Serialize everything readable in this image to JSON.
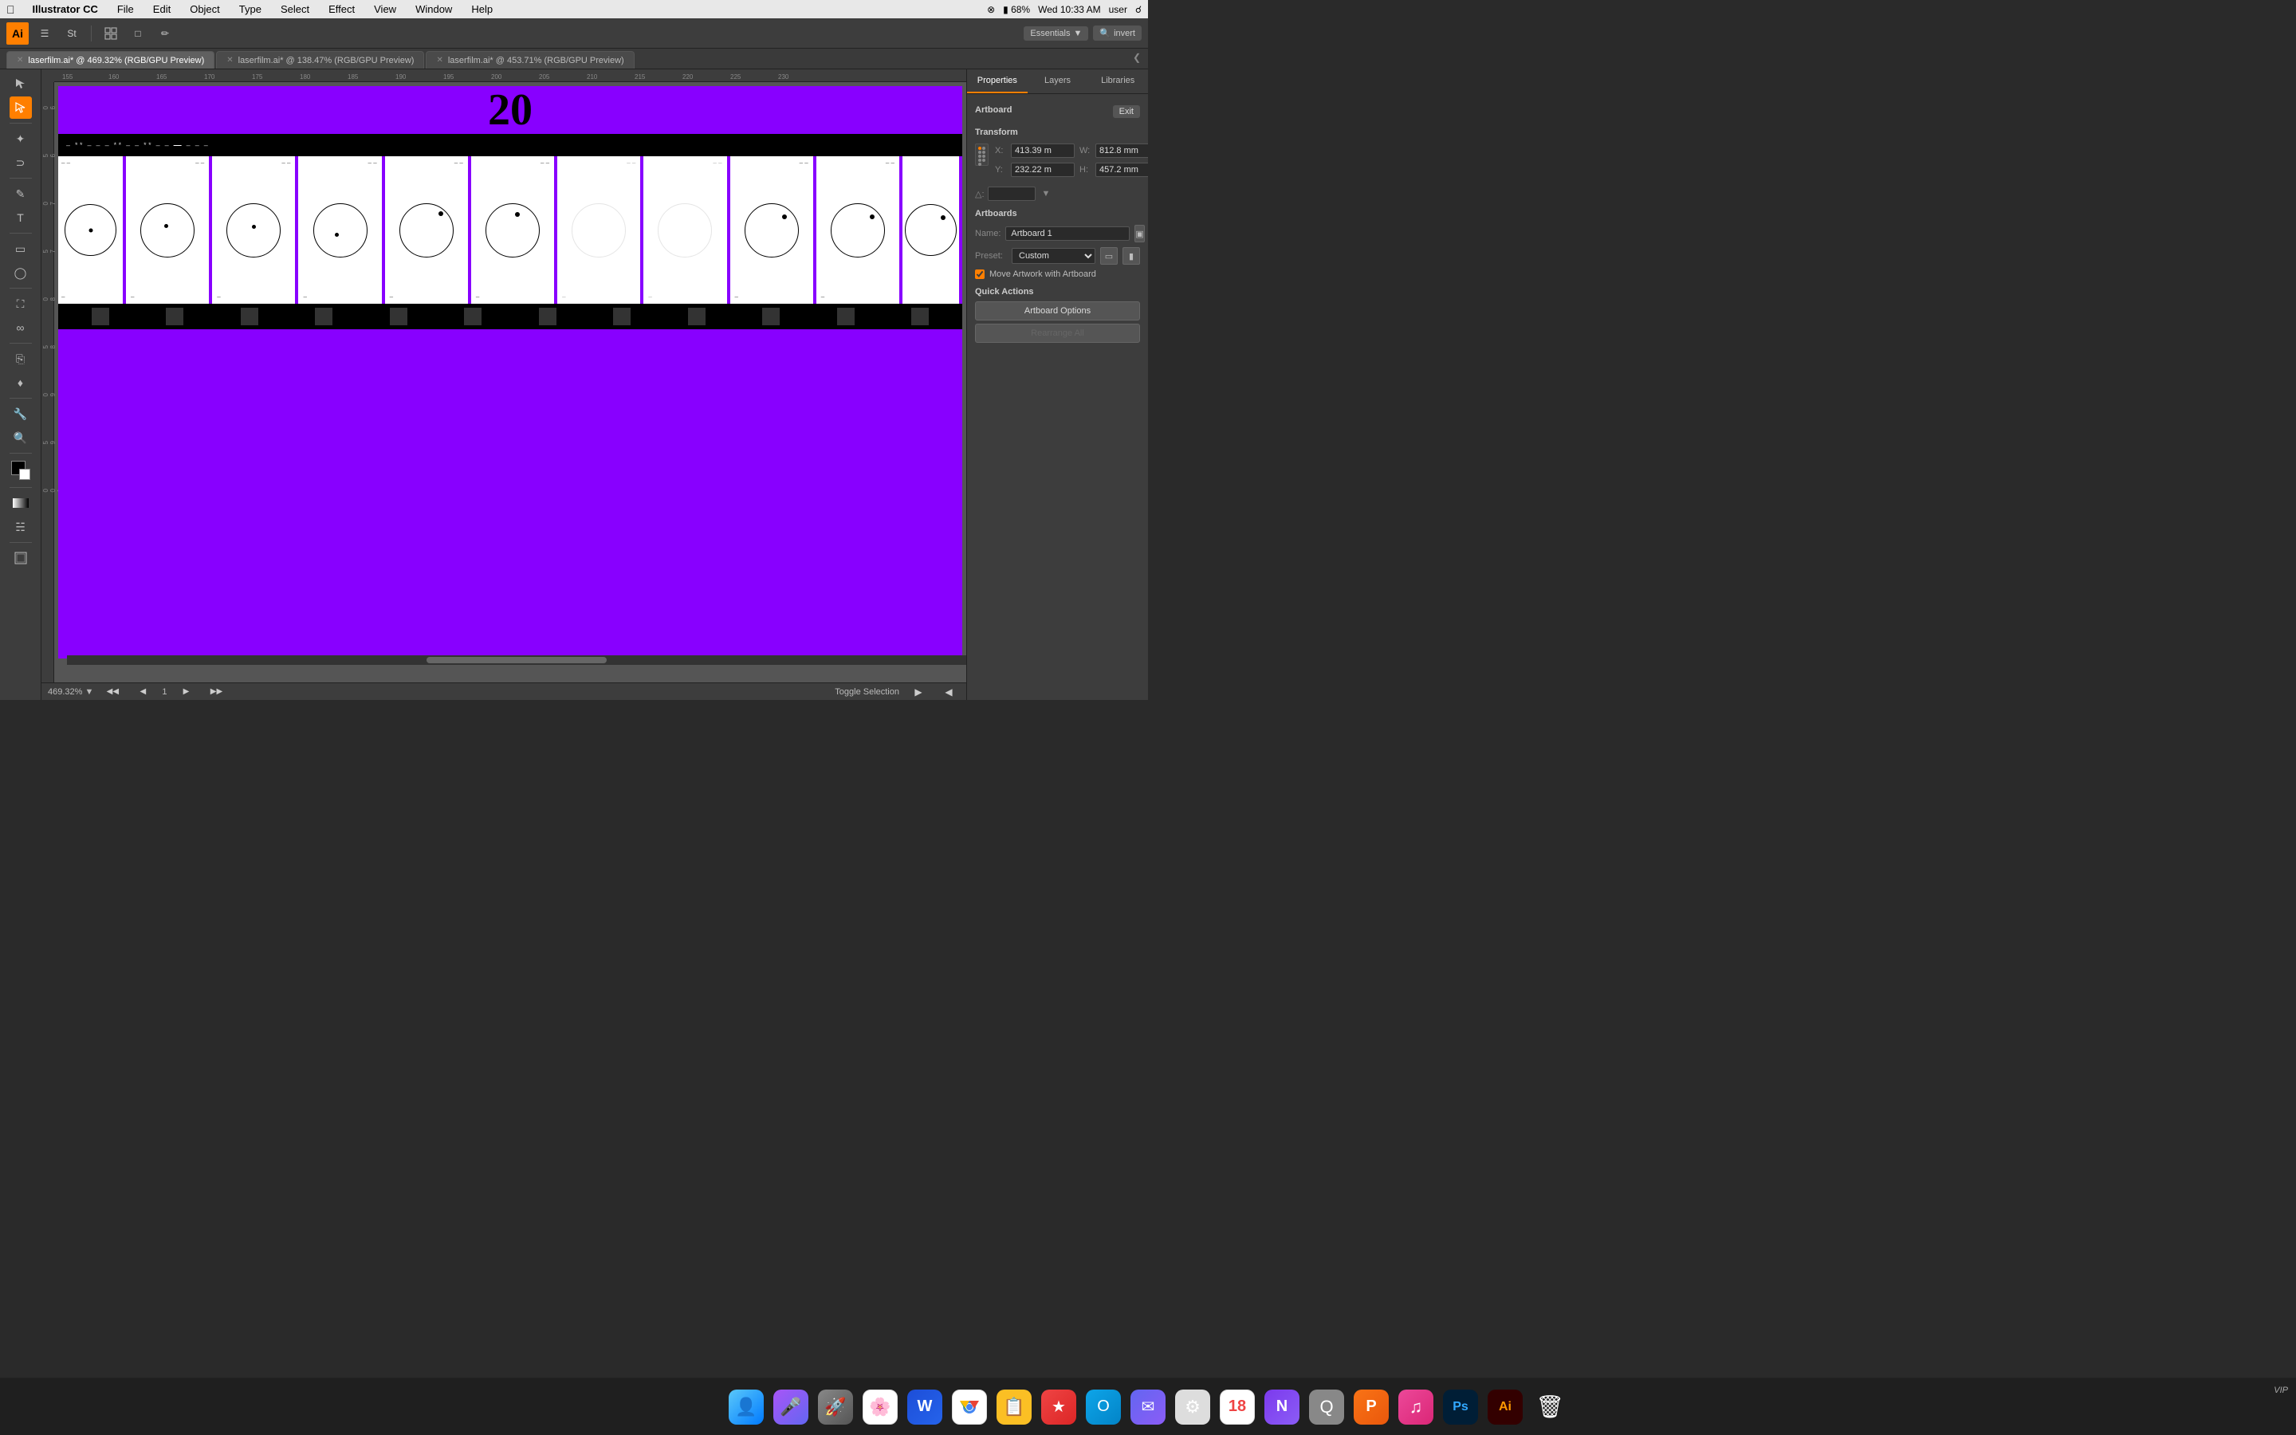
{
  "menubar": {
    "apple": "&#63743;",
    "app_name": "Illustrator CC",
    "menus": [
      "File",
      "Edit",
      "Object",
      "Type",
      "Select",
      "Effect",
      "View",
      "Window",
      "Help"
    ],
    "time": "Wed 10:33 AM",
    "user": "user",
    "battery": "68%"
  },
  "toolbar": {
    "ai_logo": "Ai",
    "essentials": "Essentials",
    "search_placeholder": "invert"
  },
  "tabs": [
    {
      "label": "laserfilm.ai* @ 469.32% (RGB/GPU Preview)",
      "active": true
    },
    {
      "label": "laserfilm.ai* @ 138.47% (RGB/GPU Preview)",
      "active": false
    },
    {
      "label": "laserfilm.ai* @ 453.71% (RGB/GPU Preview)",
      "active": false
    }
  ],
  "canvas": {
    "zoom_level": "469.32%",
    "page": "1",
    "status": "Toggle Selection",
    "ruler_numbers": [
      "155",
      "160",
      "165",
      "170",
      "175",
      "180",
      "185",
      "190",
      "195",
      "200",
      "205",
      "210",
      "215",
      "220",
      "225",
      "230"
    ],
    "film_number": "20"
  },
  "right_panel": {
    "tabs": [
      "Properties",
      "Layers",
      "Libraries"
    ],
    "active_tab": "Properties",
    "artboard_title": "Artboard",
    "exit_btn": "Exit",
    "transform_title": "Transform",
    "x_label": "X:",
    "x_value": "413.39 m",
    "y_label": "Y:",
    "y_value": "232.22 m",
    "w_label": "W:",
    "w_value": "812.8 mm",
    "h_label": "H:",
    "h_value": "457.2 mm",
    "artboards_title": "Artboards",
    "name_label": "Name:",
    "name_value": "Artboard 1",
    "preset_label": "Preset:",
    "preset_value": "Custom",
    "move_artwork_label": "Move Artwork with Artboard",
    "quick_actions_title": "Quick Actions",
    "artboard_options_btn": "Artboard Options",
    "rearrange_all_btn": "Rearrange All"
  },
  "dock": {
    "items": [
      {
        "name": "finder",
        "color": "#5ac8fa",
        "label": "Finder"
      },
      {
        "name": "siri",
        "color": "#a855f7",
        "label": "Siri"
      },
      {
        "name": "launchpad",
        "color": "#ef4444",
        "label": "Launchpad"
      },
      {
        "name": "photos",
        "color": "#f97316",
        "label": "Photos"
      },
      {
        "name": "word",
        "color": "#1d4ed8",
        "label": "Word"
      },
      {
        "name": "chrome",
        "color": "#22c55e",
        "label": "Chrome"
      },
      {
        "name": "sticky",
        "color": "#fbbf24",
        "label": "Stickies"
      },
      {
        "name": "goodlinks",
        "color": "#ef4444",
        "label": "GoodLinks"
      },
      {
        "name": "outlook",
        "color": "#0ea5e9",
        "label": "Outlook"
      },
      {
        "name": "airmail",
        "color": "#6366f1",
        "label": "Airmail"
      },
      {
        "name": "system-prefs",
        "color": "#888",
        "label": "System Preferences"
      },
      {
        "name": "calendar",
        "color": "#ef4444",
        "label": "Calendar"
      },
      {
        "name": "onenote",
        "color": "#a855f7",
        "label": "OneNote"
      },
      {
        "name": "qreate",
        "color": "#888",
        "label": "Qreate"
      },
      {
        "name": "powerpoint",
        "color": "#f97316",
        "label": "PowerPoint"
      },
      {
        "name": "music",
        "color": "#ec4899",
        "label": "Music"
      },
      {
        "name": "photoshop",
        "color": "#0ea5e9",
        "label": "Photoshop"
      },
      {
        "name": "illustrator",
        "color": "#f97316",
        "label": "Illustrator"
      },
      {
        "name": "trash",
        "color": "#888",
        "label": "Trash"
      }
    ]
  }
}
